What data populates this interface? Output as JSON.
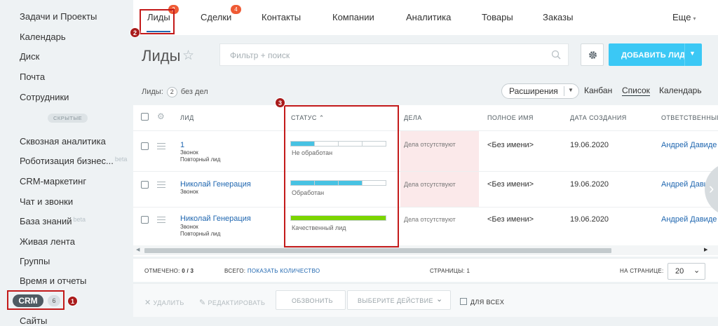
{
  "sidebar": {
    "items": [
      {
        "label": "Задачи и Проекты"
      },
      {
        "label": "Календарь"
      },
      {
        "label": "Диск"
      },
      {
        "label": "Почта"
      },
      {
        "label": "Сотрудники"
      },
      {
        "label": "Сквозная аналитика"
      },
      {
        "label": "Роботизация бизнес...",
        "badge": "beta"
      },
      {
        "label": "CRM-маркетинг"
      },
      {
        "label": "Чат и звонки"
      },
      {
        "label": "База знаний",
        "badge": "beta"
      },
      {
        "label": "Живая лента"
      },
      {
        "label": "Группы"
      },
      {
        "label": "Время и отчеты"
      },
      {
        "label": "Сайты"
      }
    ],
    "hidden_label": "СКРЫТЫЕ",
    "crm": {
      "label": "CRM",
      "count": "6"
    }
  },
  "markers": {
    "m1": "1",
    "m2": "2",
    "m3": "3"
  },
  "topnav": {
    "tabs": [
      {
        "label": "Лиды",
        "badge": "2"
      },
      {
        "label": "Сделки",
        "badge": "4"
      },
      {
        "label": "Контакты"
      },
      {
        "label": "Компании"
      },
      {
        "label": "Аналитика"
      },
      {
        "label": "Товары"
      },
      {
        "label": "Заказы"
      }
    ],
    "more": "Еще"
  },
  "header": {
    "title": "Лиды",
    "search_placeholder": "Фильтр + поиск",
    "add_button": "ДОБАВИТЬ ЛИД"
  },
  "toolbar": {
    "counter_prefix": "Лиды:",
    "counter_value": "2",
    "counter_suffix": "без дел",
    "extensions": "Расширения",
    "views": [
      "Канбан",
      "Список",
      "Календарь"
    ],
    "active_view": "Список"
  },
  "grid": {
    "columns": [
      "ЛИД",
      "СТАТУС",
      "ДЕЛА",
      "ПОЛНОЕ ИМЯ",
      "ДАТА СОЗДАНИЯ",
      "ОТВЕТСТВЕННЫЙ"
    ],
    "rows": [
      {
        "name": "1",
        "source": "Звонок",
        "type": "Повторный лид",
        "status": "Не обработан",
        "status_progress": 0.25,
        "status_color": "#47c2e3",
        "deals": "Дела отсутствуют",
        "full_name": "<Без имени>",
        "date": "19.06.2020",
        "responsible": "Андрей Давиде"
      },
      {
        "name": "Николай Генерация",
        "source": "Звонок",
        "type": "",
        "status": "Обработан",
        "status_progress": 0.75,
        "status_color": "#47c2e3",
        "deals": "Дела отсутствуют",
        "full_name": "<Без имени>",
        "date": "19.06.2020",
        "responsible": "Андрей Давиде"
      },
      {
        "name": "Николай Генерация",
        "source": "Звонок",
        "type": "Повторный лид",
        "status": "Качественный лид",
        "status_progress": 1.0,
        "status_color": "#7bd500",
        "deals": "Дела отсутствуют",
        "full_name": "<Без имени>",
        "date": "19.06.2020",
        "responsible": "Андрей Давиде"
      }
    ]
  },
  "footer": {
    "marked_label": "ОТМЕЧЕНО:",
    "marked_value": "0 / 3",
    "total_label": "ВСЕГО:",
    "total_link": "ПОКАЗАТЬ КОЛИЧЕСТВО",
    "pages_label": "СТРАНИЦЫ:",
    "pages_value": "1",
    "per_page_label": "НА СТРАНИЦЕ:",
    "per_page_value": "20"
  },
  "actions": {
    "delete": "УДАЛИТЬ",
    "edit": "РЕДАКТИРОВАТЬ",
    "call": "ОБЗВОНИТЬ",
    "choose": "ВЫБЕРИТЕ ДЕЙСТВИЕ",
    "for_all": "ДЛЯ ВСЕХ"
  }
}
